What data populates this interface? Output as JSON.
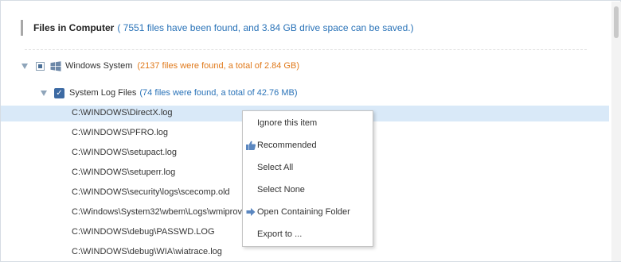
{
  "header": {
    "title": "Files in Computer",
    "info": "( 7551 files have been found, and 3.84 GB drive space can be saved.)"
  },
  "tree": {
    "group": {
      "label": "Windows System",
      "note": "(2137 files were found, a total of 2.84 GB)",
      "icon": "windows-logo-icon",
      "checkbox": "partial"
    },
    "subgroup": {
      "label": "System Log Files",
      "note": "(74 files were found, a total of 42.76 MB)",
      "checkbox": "checked"
    },
    "files": [
      "C:\\WINDOWS\\DirectX.log",
      "C:\\WINDOWS\\PFRO.log",
      "C:\\WINDOWS\\setupact.log",
      "C:\\WINDOWS\\setuperr.log",
      "C:\\WINDOWS\\security\\logs\\scecomp.old",
      "C:\\Windows\\System32\\wbem\\Logs\\wmiprov.",
      "C:\\WINDOWS\\debug\\PASSWD.LOG",
      "C:\\WINDOWS\\debug\\WIA\\wiatrace.log"
    ]
  },
  "context_menu": {
    "items": [
      {
        "label": "Ignore this item",
        "icon": ""
      },
      {
        "label": "Recommended",
        "icon": "thumbs-up-icon"
      },
      {
        "label": "Select All",
        "icon": ""
      },
      {
        "label": "Select None",
        "icon": ""
      },
      {
        "label": "Open Containing Folder",
        "icon": "arrow-right-icon"
      },
      {
        "label": "Export to ...",
        "icon": ""
      }
    ]
  },
  "colors": {
    "accent_blue": "#2a73b8",
    "note_orange": "#e07a1c",
    "selection": "#d9e9f8",
    "checkbox": "#3d6aa3"
  }
}
